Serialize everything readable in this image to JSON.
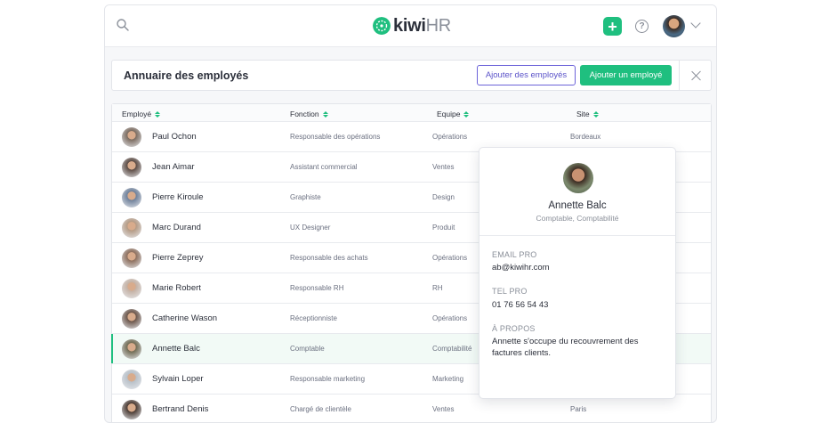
{
  "header": {
    "logo_kiwi": "kiwi",
    "logo_hr": "HR",
    "brand_color": "#1fbf7f"
  },
  "page": {
    "title": "Annuaire des employés",
    "add_employees_label": "Ajouter des employés",
    "add_employee_label": "Ajouter un employé"
  },
  "table": {
    "columns": [
      "Employé",
      "Fonction",
      "Equipe",
      "Site"
    ],
    "rows": [
      {
        "name": "Paul Ochon",
        "fonction": "Responsable des opérations",
        "equipe": "Opérations",
        "site": "Bordeaux",
        "avatar_color": "#7a6a5e"
      },
      {
        "name": "Jean Aimar",
        "fonction": "Assistant commercial",
        "equipe": "Ventes",
        "site": "",
        "avatar_color": "#5b4a42"
      },
      {
        "name": "Pierre Kiroule",
        "fonction": "Graphiste",
        "equipe": "Design",
        "site": "",
        "avatar_color": "#6d7f99"
      },
      {
        "name": "Marc Durand",
        "fonction": "UX Designer",
        "equipe": "Produit",
        "site": "",
        "avatar_color": "#b49a84"
      },
      {
        "name": "Pierre Zeprey",
        "fonction": "Responsable des achats",
        "equipe": "Opérations",
        "site": "",
        "avatar_color": "#8c6e5c"
      },
      {
        "name": "Marie Robert",
        "fonction": "Responsable RH",
        "equipe": "RH",
        "site": "",
        "avatar_color": "#c4b1a4"
      },
      {
        "name": "Catherine Wason",
        "fonction": "Réceptionniste",
        "equipe": "Opérations",
        "site": "",
        "avatar_color": "#6a5448"
      },
      {
        "name": "Annette Balc",
        "fonction": "Comptable",
        "equipe": "Comptabilité",
        "site": "",
        "avatar_color": "#6f6a52",
        "active": true
      },
      {
        "name": "Sylvain Loper",
        "fonction": "Responsable marketing",
        "equipe": "Marketing",
        "site": "",
        "avatar_color": "#b8c0c8"
      },
      {
        "name": "Bertrand Denis",
        "fonction": "Chargé de clientèle",
        "equipe": "Ventes",
        "site": "Paris",
        "avatar_color": "#4a3a32"
      }
    ]
  },
  "popover": {
    "name": "Annette Balc",
    "role": "Comptable, Comptabilité",
    "email_label": "EMAIL PRO",
    "email": "ab@kiwihr.com",
    "tel_label": "TEL PRO",
    "tel": "01 76 56 54 43",
    "about_label": "À PROPOS",
    "about": "Annette s'occupe du recouvrement des factures clients."
  }
}
